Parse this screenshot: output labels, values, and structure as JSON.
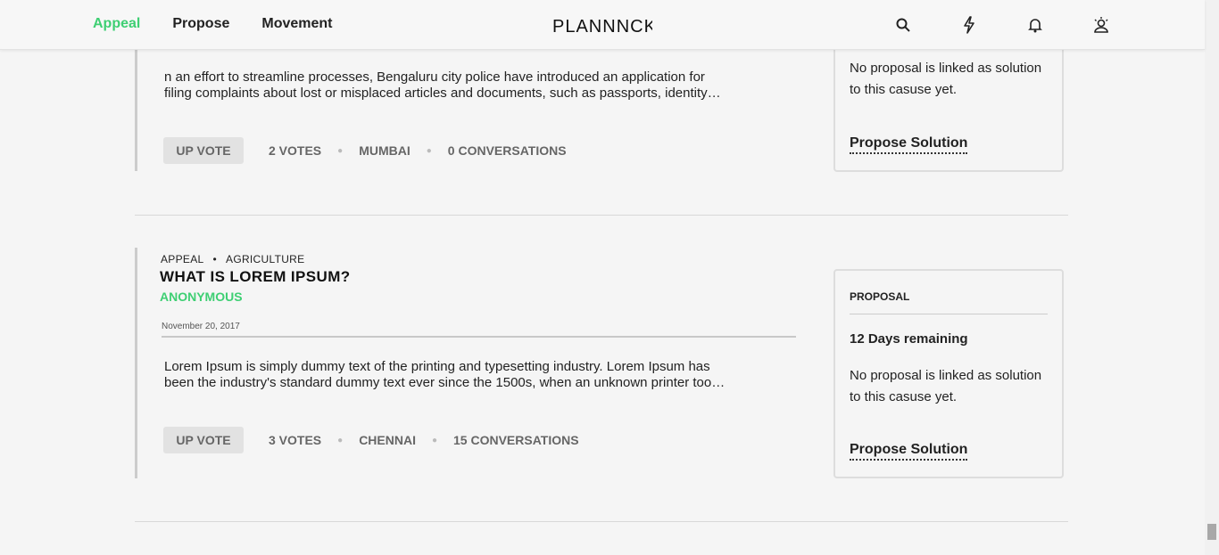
{
  "nav": {
    "items": [
      {
        "label": "Appeal",
        "active": true
      },
      {
        "label": "Propose",
        "active": false
      },
      {
        "label": "Movement",
        "active": false
      }
    ],
    "logo": "PLANNNCK"
  },
  "header_icons": [
    "search-icon",
    "bolt-icon",
    "bell-icon",
    "user-icon"
  ],
  "accent_color": "#3ecf73",
  "posts": [
    {
      "desc_line1": "n an effort to streamline processes, Bengaluru city police have introduced an application for",
      "desc_line2": "filing complaints about lost or misplaced articles and documents, such as passports, identity…",
      "upvote": "UP VOTE",
      "votes": "2 VOTES",
      "city": "MUMBAI",
      "conversations": "0 CONVERSATIONS",
      "panel": {
        "text": "No proposal is linked as solution to this casuse yet.",
        "link": "Propose Solution"
      }
    },
    {
      "category": "APPEAL",
      "subcategory": "AGRICULTURE",
      "title": "WHAT IS LOREM IPSUM?",
      "author": "ANONYMOUS",
      "date": "November 20, 2017",
      "desc_line1": "Lorem Ipsum is simply dummy text of the printing and typesetting industry. Lorem Ipsum has",
      "desc_line2": "been the industry's standard dummy text ever since the 1500s, when an unknown printer too…",
      "upvote": "UP VOTE",
      "votes": "3 VOTES",
      "city": "CHENNAI",
      "conversations": "15 CONVERSATIONS",
      "panel": {
        "label": "PROPOSAL",
        "days": "12 Days remaining",
        "text": "No proposal is linked as solution to this casuse yet.",
        "link": "Propose Solution"
      }
    }
  ]
}
